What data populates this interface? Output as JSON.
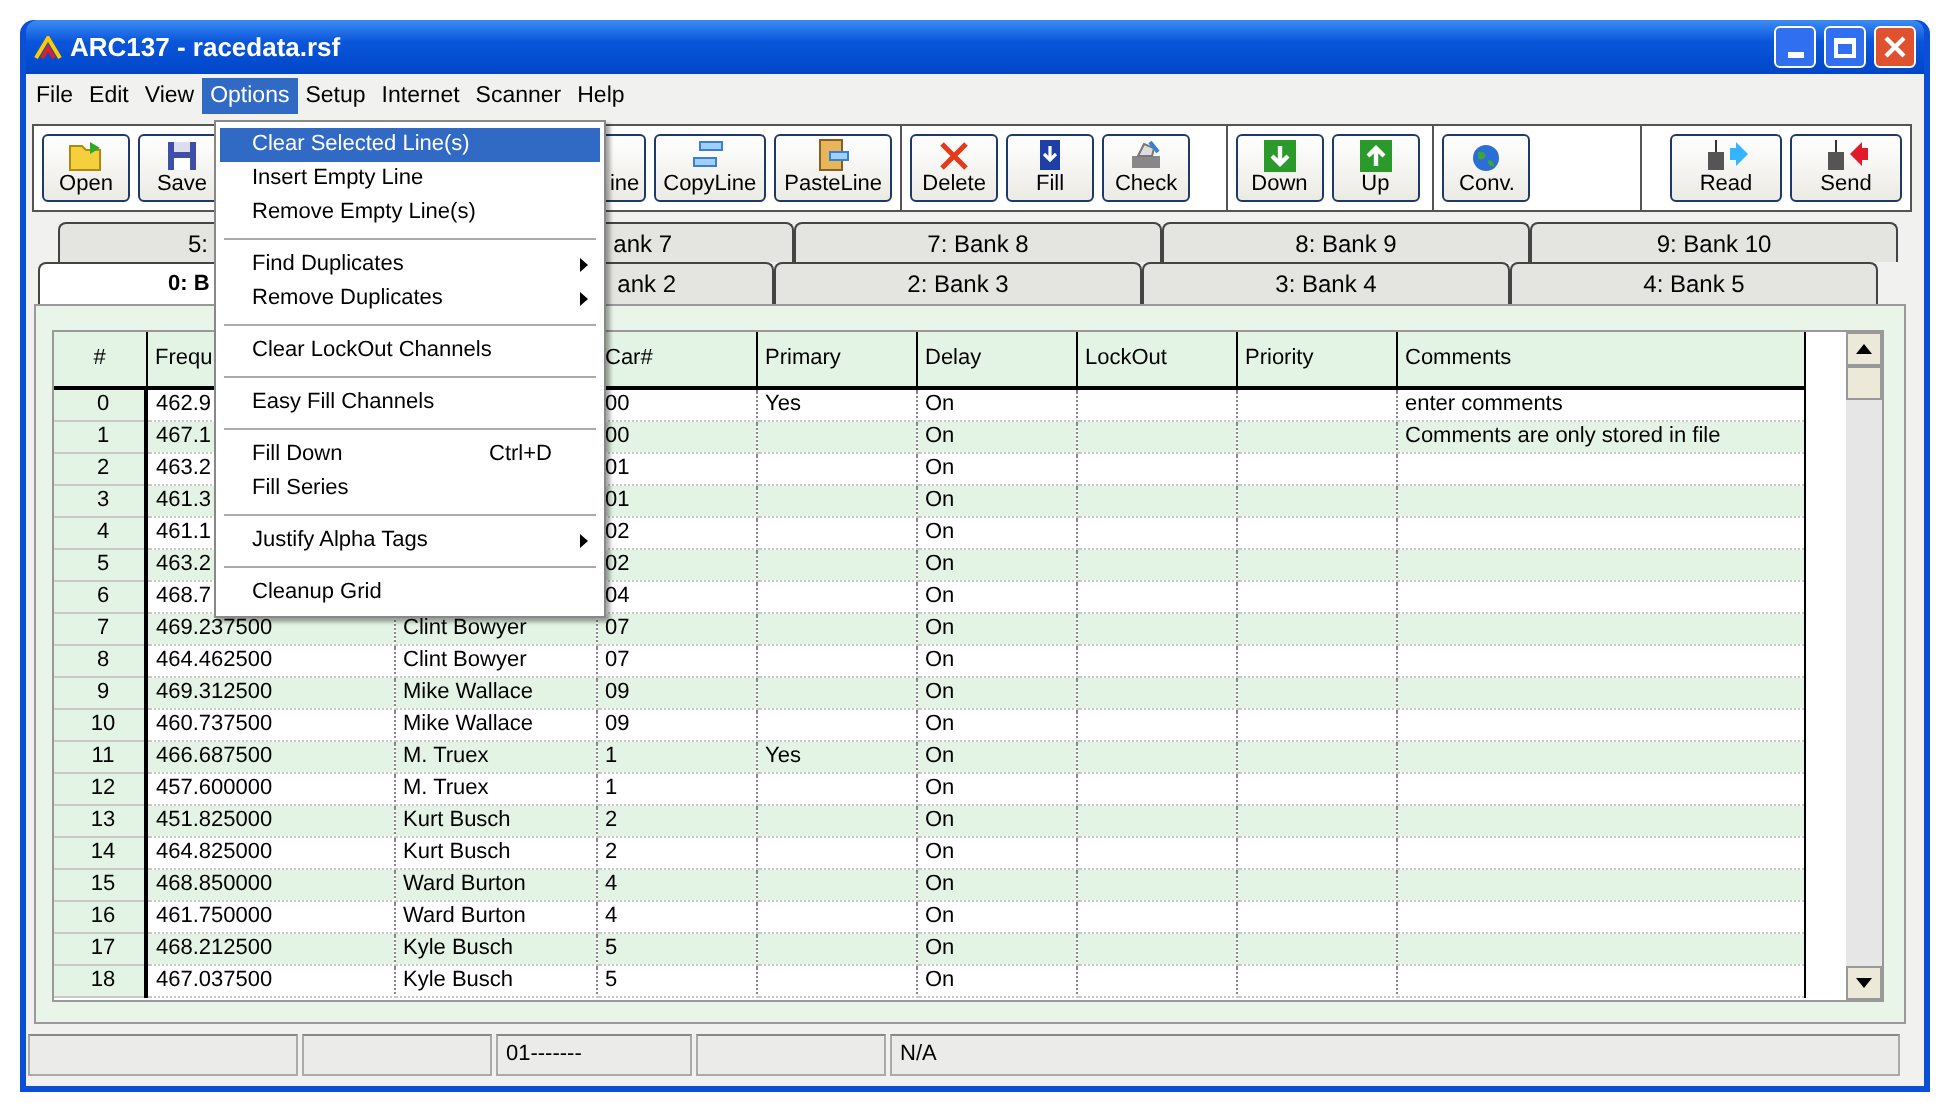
{
  "window": {
    "title": "ARC137 - racedata.rsf"
  },
  "menu_bar": [
    {
      "label": "File",
      "selected": false
    },
    {
      "label": "Edit",
      "selected": false
    },
    {
      "label": "View",
      "selected": false
    },
    {
      "label": "Options",
      "selected": true
    },
    {
      "label": "Setup",
      "selected": false
    },
    {
      "label": "Internet",
      "selected": false
    },
    {
      "label": "Scanner",
      "selected": false
    },
    {
      "label": "Help",
      "selected": false
    }
  ],
  "options_menu": [
    {
      "kind": "item",
      "label": "Clear Selected Line(s)",
      "selected": true,
      "submenu": false
    },
    {
      "kind": "item",
      "label": "Insert Empty Line",
      "selected": false,
      "submenu": false
    },
    {
      "kind": "item",
      "label": "Remove Empty Line(s)",
      "selected": false,
      "submenu": false
    },
    {
      "kind": "separator"
    },
    {
      "kind": "item",
      "label": "Find Duplicates",
      "selected": false,
      "submenu": true
    },
    {
      "kind": "item",
      "label": "Remove Duplicates",
      "selected": false,
      "submenu": true
    },
    {
      "kind": "separator"
    },
    {
      "kind": "item",
      "label": "Clear LockOut Channels",
      "selected": false,
      "submenu": false
    },
    {
      "kind": "separator"
    },
    {
      "kind": "item",
      "label": "Easy Fill Channels",
      "selected": false,
      "submenu": false
    },
    {
      "kind": "separator"
    },
    {
      "kind": "item",
      "label": "Fill Down",
      "shortcut": "Ctrl+D",
      "selected": false,
      "submenu": false
    },
    {
      "kind": "item",
      "label": "Fill Series",
      "selected": false,
      "submenu": false
    },
    {
      "kind": "separator"
    },
    {
      "kind": "item",
      "label": "Justify Alpha Tags",
      "selected": false,
      "submenu": true
    },
    {
      "kind": "separator"
    },
    {
      "kind": "item",
      "label": "Cleanup Grid",
      "selected": false,
      "submenu": false
    }
  ],
  "toolbar": [
    {
      "buttons": [
        {
          "label": "Open"
        },
        {
          "label": "Save"
        },
        {
          "label": "ine"
        },
        {
          "label": "CopyLine"
        },
        {
          "label": "PasteLine"
        }
      ]
    },
    {
      "buttons": [
        {
          "label": "Delete"
        },
        {
          "label": "Fill"
        },
        {
          "label": "Check"
        }
      ]
    },
    {
      "buttons": [
        {
          "label": "Down"
        },
        {
          "label": "Up"
        }
      ]
    },
    {
      "buttons": [
        {
          "label": "Conv."
        }
      ]
    },
    {
      "buttons": [
        {
          "label": "Read"
        },
        {
          "label": "Send"
        }
      ]
    }
  ],
  "tabs": [
    [
      {
        "label": "5:",
        "selected": false
      },
      {
        "label": "ank 7",
        "selected": false
      },
      {
        "label": "7: Bank 8",
        "selected": false
      },
      {
        "label": "8: Bank 9",
        "selected": false
      },
      {
        "label": "9: Bank 10",
        "selected": false
      }
    ],
    [
      {
        "label": "0: B",
        "selected": true
      },
      {
        "label": "ank 2",
        "selected": false
      },
      {
        "label": "2: Bank 3",
        "selected": false
      },
      {
        "label": "3: Bank 4",
        "selected": false
      },
      {
        "label": "4: Bank 5",
        "selected": false
      }
    ]
  ],
  "grid": {
    "columns": {
      "number": "#",
      "frequency": "Frequ",
      "car": "Car#",
      "primary": "Primary",
      "delay": "Delay",
      "lockout": "LockOut",
      "priority": "Priority",
      "comments": "Comments"
    },
    "rows": [
      {
        "number": "0",
        "frequency": "462.9",
        "car": "00",
        "primary": "Yes",
        "delay": "On",
        "comments": "enter comments"
      },
      {
        "number": "1",
        "frequency": "467.1",
        "car": "00",
        "delay": "On",
        "comments": "Comments are only stored in file"
      },
      {
        "number": "2",
        "frequency": "463.2",
        "car": "01",
        "delay": "On"
      },
      {
        "number": "3",
        "frequency": "461.3",
        "car": "01",
        "delay": "On"
      },
      {
        "number": "4",
        "frequency": "461.1",
        "car": "02",
        "delay": "On"
      },
      {
        "number": "5",
        "frequency": "463.2",
        "car": "02",
        "delay": "On"
      },
      {
        "number": "6",
        "frequency": "468.7",
        "car": "04",
        "delay": "On"
      },
      {
        "number": "7",
        "frequency": "469.237500",
        "column_3": "Clint Bowyer",
        "car": "07",
        "delay": "On"
      },
      {
        "number": "8",
        "frequency": "464.462500",
        "column_3": "Clint Bowyer",
        "car": "07",
        "delay": "On"
      },
      {
        "number": "9",
        "frequency": "469.312500",
        "column_3": "Mike Wallace",
        "car": "09",
        "delay": "On"
      },
      {
        "number": "10",
        "frequency": "460.737500",
        "column_3": "Mike Wallace",
        "car": "09",
        "delay": "On"
      },
      {
        "number": "11",
        "frequency": "466.687500",
        "column_3": "M. Truex",
        "car": "1",
        "primary": "Yes",
        "delay": "On"
      },
      {
        "number": "12",
        "frequency": "457.600000",
        "column_3": "M. Truex",
        "car": "1",
        "delay": "On"
      },
      {
        "number": "13",
        "frequency": "451.825000",
        "column_3": "Kurt Busch",
        "car": "2",
        "delay": "On"
      },
      {
        "number": "14",
        "frequency": "464.825000",
        "column_3": "Kurt Busch",
        "car": "2",
        "delay": "On"
      },
      {
        "number": "15",
        "frequency": "468.850000",
        "column_3": "Ward Burton",
        "car": "4",
        "delay": "On"
      },
      {
        "number": "16",
        "frequency": "461.750000",
        "column_3": "Ward Burton",
        "car": "4",
        "delay": "On"
      },
      {
        "number": "17",
        "frequency": "468.212500",
        "column_3": "Kyle Busch",
        "car": "5",
        "delay": "On"
      },
      {
        "number": "18",
        "frequency": "467.037500",
        "column_3": "Kyle Busch",
        "car": "5",
        "delay": "On"
      }
    ]
  },
  "status_bar": {
    "panel_3": "01-------",
    "panel_5": "N/A"
  }
}
